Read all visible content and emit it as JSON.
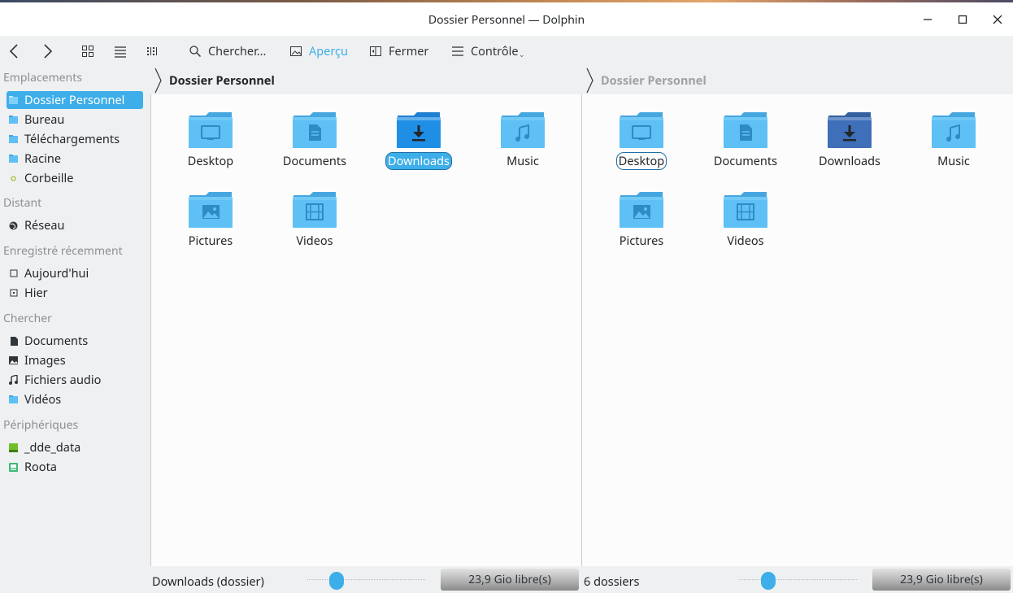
{
  "window": {
    "title": "Dossier Personnel — Dolphin",
    "minimize_icon": "minimize-icon",
    "maximize_icon": "maximize-icon",
    "close_icon": "close-icon"
  },
  "toolbar": {
    "back_icon": "back-icon",
    "forward_icon": "forward-icon",
    "icons_view_icon": "icons-view-icon",
    "details_view_icon": "details-view-icon",
    "compact_view_icon": "compact-view-icon",
    "search_label": "Chercher...",
    "preview_label": "Aperçu",
    "close_label": "Fermer",
    "control_label": "Contrôle"
  },
  "sidebar": {
    "places_header": "Emplacements",
    "places": [
      {
        "label": "Dossier Personnel",
        "icon": "home-folder-icon",
        "selected": true
      },
      {
        "label": "Bureau",
        "icon": "desktop-folder-icon"
      },
      {
        "label": "Téléchargements",
        "icon": "downloads-folder-icon"
      },
      {
        "label": "Racine",
        "icon": "root-folder-icon"
      },
      {
        "label": "Corbeille",
        "icon": "trash-icon"
      }
    ],
    "remote_header": "Distant",
    "remote": [
      {
        "label": "Réseau",
        "icon": "network-icon"
      }
    ],
    "recent_header": "Enregistré récemment",
    "recent": [
      {
        "label": "Aujourd'hui",
        "icon": "calendar-today-icon"
      },
      {
        "label": "Hier",
        "icon": "calendar-yesterday-icon"
      }
    ],
    "search_header": "Chercher",
    "search": [
      {
        "label": "Documents",
        "icon": "document-icon"
      },
      {
        "label": "Images",
        "icon": "image-icon"
      },
      {
        "label": "Fichiers audio",
        "icon": "audio-icon"
      },
      {
        "label": "Vidéos",
        "icon": "video-folder-icon"
      }
    ],
    "devices_header": "Périphériques",
    "devices": [
      {
        "label": "_dde_data",
        "icon": "drive-icon"
      },
      {
        "label": "Roota",
        "icon": "drive-root-icon"
      }
    ]
  },
  "left_pane": {
    "breadcrumb": "Dossier Personnel",
    "files": [
      {
        "name": "Desktop",
        "icon": "desktop-folder-icon"
      },
      {
        "name": "Documents",
        "icon": "documents-folder-icon"
      },
      {
        "name": "Downloads",
        "icon": "downloads-folder-icon",
        "selected": true
      },
      {
        "name": "Music",
        "icon": "music-folder-icon"
      },
      {
        "name": "Pictures",
        "icon": "pictures-folder-icon"
      },
      {
        "name": "Videos",
        "icon": "videos-folder-icon"
      }
    ],
    "status": "Downloads (dossier)",
    "free_space": "23,9 Gio libre(s)",
    "zoom_level": 0.25,
    "free_space_fill": 0.14
  },
  "right_pane": {
    "breadcrumb": "Dossier Personnel",
    "files": [
      {
        "name": "Desktop",
        "icon": "desktop-folder-icon",
        "current": true
      },
      {
        "name": "Documents",
        "icon": "documents-folder-icon"
      },
      {
        "name": "Downloads",
        "icon": "downloads-folder-icon"
      },
      {
        "name": "Music",
        "icon": "music-folder-icon"
      },
      {
        "name": "Pictures",
        "icon": "pictures-folder-icon"
      },
      {
        "name": "Videos",
        "icon": "videos-folder-icon"
      }
    ],
    "status": "6 dossiers",
    "free_space": "23,9 Gio libre(s)",
    "zoom_level": 0.25,
    "free_space_fill": 0.14
  },
  "colors": {
    "accent": "#3daee9",
    "folder": "#5ec0f5",
    "folder_tab": "#46a6e0",
    "folder_selected": "#1f8fe6",
    "folder_dark": "#3e6fb8"
  }
}
